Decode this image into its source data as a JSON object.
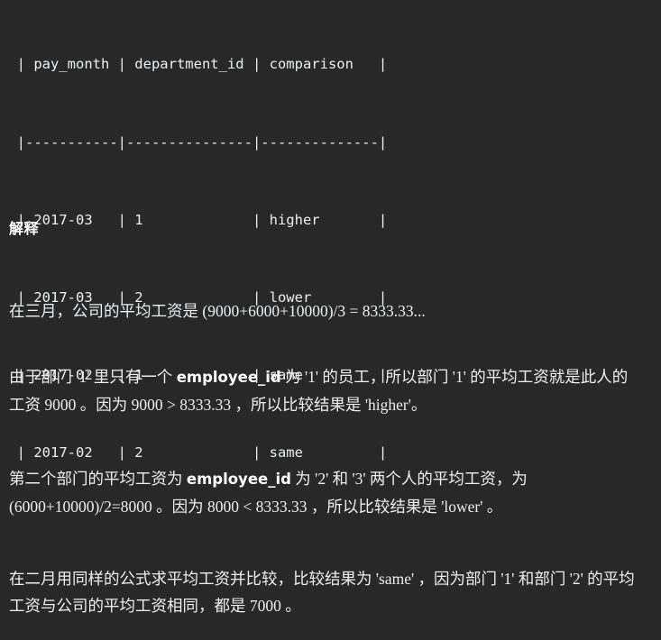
{
  "colors": {
    "background": "#282828",
    "text": "#eceff1",
    "heading": "#ffffff"
  },
  "result_table": {
    "columns": [
      "pay_month",
      "department_id",
      "comparison"
    ],
    "rows": [
      {
        "pay_month": "2017-03",
        "department_id": "1",
        "comparison": "higher"
      },
      {
        "pay_month": "2017-03",
        "department_id": "2",
        "comparison": "lower"
      },
      {
        "pay_month": "2017-02",
        "department_id": "1",
        "comparison": "same"
      },
      {
        "pay_month": "2017-02",
        "department_id": "2",
        "comparison": "same"
      }
    ],
    "raw_lines": [
      "  | pay_month | department_id | comparison   |",
      "  |-----------|---------------|--------------|",
      "  | 2017-03   | 1             | higher       |",
      "  | 2017-03   | 2             | lower        |",
      "  | 2017-02   | 1             | same         |",
      "  | 2017-02   | 2             | same         |"
    ]
  },
  "explanation": {
    "heading": "解释",
    "paragraphs": {
      "p1": "在三月，公司的平均工资是 (9000+6000+10000)/3 = 8333.33...",
      "p2_before": "由于部门 '1' 里只有一个 ",
      "p2_code": "employee_id",
      "p2_after": " 为 '1' 的员工，所以部门 '1' 的平均工资就是此人的工资 9000 。因为 9000 > 8333.33 ，所以比较结果是 'higher'。",
      "p3_before": "第二个部门的平均工资为 ",
      "p3_code": "employee_id",
      "p3_after": " 为 '2' 和 '3' 两个人的平均工资，为 (6000+10000)/2=8000 。因为 8000 < 8333.33 ，所以比较结果是 'lower' 。",
      "p4": "在二月用同样的公式求平均工资并比较，比较结果为 'same' ，因为部门 '1' 和部门 '2' 的平均工资与公司的平均工资相同，都是 7000 。"
    }
  }
}
